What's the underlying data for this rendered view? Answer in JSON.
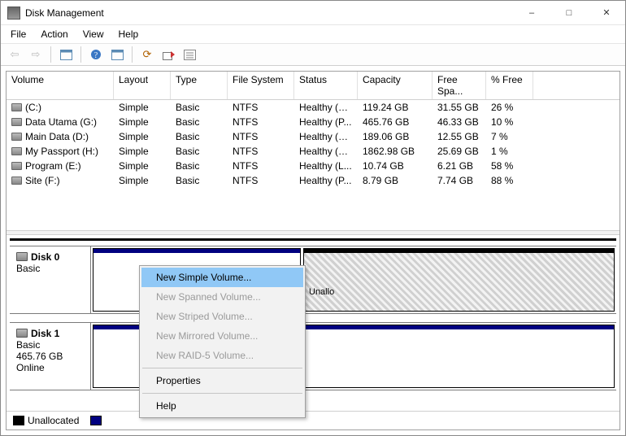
{
  "window": {
    "title": "Disk Management"
  },
  "menu": {
    "file": "File",
    "action": "Action",
    "view": "View",
    "help": "Help"
  },
  "columns": {
    "volume": "Volume",
    "layout": "Layout",
    "type": "Type",
    "fs": "File System",
    "status": "Status",
    "capacity": "Capacity",
    "free": "Free Spa...",
    "pct": "% Free"
  },
  "volumes": [
    {
      "name": "(C:)",
      "layout": "Simple",
      "type": "Basic",
      "fs": "NTFS",
      "status": "Healthy (B...",
      "capacity": "119.24 GB",
      "free": "31.55 GB",
      "pct": "26 %"
    },
    {
      "name": "Data Utama (G:)",
      "layout": "Simple",
      "type": "Basic",
      "fs": "NTFS",
      "status": "Healthy (P...",
      "capacity": "465.76 GB",
      "free": "46.33 GB",
      "pct": "10 %"
    },
    {
      "name": "Main Data (D:)",
      "layout": "Simple",
      "type": "Basic",
      "fs": "NTFS",
      "status": "Healthy (S...",
      "capacity": "189.06 GB",
      "free": "12.55 GB",
      "pct": "7 %"
    },
    {
      "name": "My Passport (H:)",
      "layout": "Simple",
      "type": "Basic",
      "fs": "NTFS",
      "status": "Healthy (B...",
      "capacity": "1862.98 GB",
      "free": "25.69 GB",
      "pct": "1 %"
    },
    {
      "name": "Program (E:)",
      "layout": "Simple",
      "type": "Basic",
      "fs": "NTFS",
      "status": "Healthy (L...",
      "capacity": "10.74 GB",
      "free": "6.21 GB",
      "pct": "58 %"
    },
    {
      "name": "Site (F:)",
      "layout": "Simple",
      "type": "Basic",
      "fs": "NTFS",
      "status": "Healthy (P...",
      "capacity": "8.79 GB",
      "free": "7.74 GB",
      "pct": "88 %"
    }
  ],
  "disks": {
    "d0": {
      "name": "Disk 0",
      "type": "Basic",
      "unalloc_label": "Unallo"
    },
    "d1": {
      "name": "Disk 1",
      "type": "Basic",
      "capacity": "465.76 GB",
      "status": "Online"
    }
  },
  "legend": {
    "unallocated": "Unallocated"
  },
  "context_menu": {
    "new_simple": "New Simple Volume...",
    "new_spanned": "New Spanned Volume...",
    "new_striped": "New Striped Volume...",
    "new_mirrored": "New Mirrored Volume...",
    "new_raid5": "New RAID-5 Volume...",
    "properties": "Properties",
    "help": "Help"
  }
}
